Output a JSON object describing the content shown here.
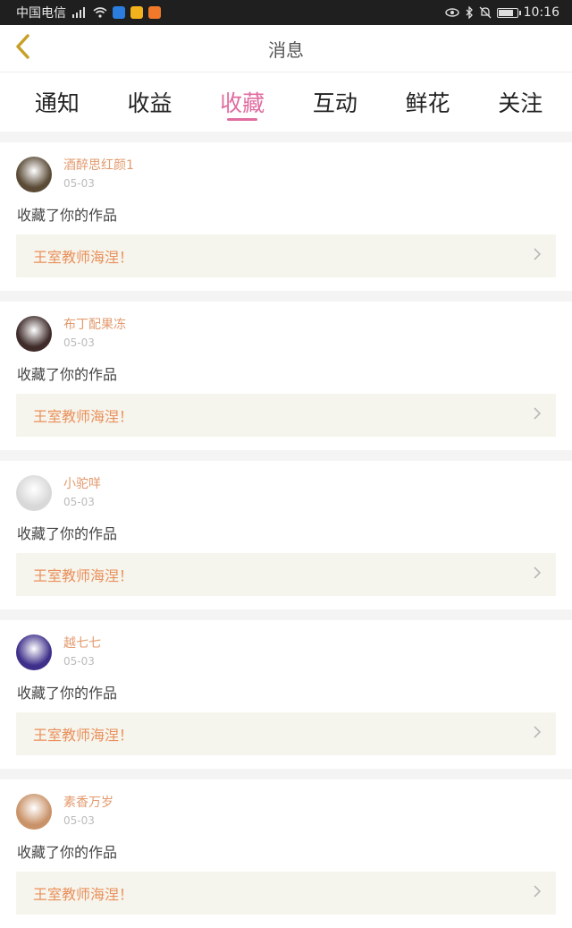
{
  "status_bar": {
    "carrier": "中国电信",
    "network": "3G",
    "time": "10:16",
    "battery_level": 0.85
  },
  "header": {
    "title": "消息",
    "back_icon": "chevron-left-icon",
    "back_icon_color": "#c8a028"
  },
  "tabs": [
    {
      "label": "通知",
      "active": false
    },
    {
      "label": "收益",
      "active": false
    },
    {
      "label": "收藏",
      "active": true
    },
    {
      "label": "互动",
      "active": false
    },
    {
      "label": "鲜花",
      "active": false
    },
    {
      "label": "关注",
      "active": false
    }
  ],
  "colors": {
    "accent": "#e06ca0",
    "username": "#e39a6e",
    "work_title": "#e9905b",
    "work_bg": "#f6f5ed"
  },
  "notifications": [
    {
      "user": "酒醉思红颜1",
      "date": "05-03",
      "action": "收藏了你的作品",
      "work": "王室教师海涅！",
      "avatar_color": "#5a4a36"
    },
    {
      "user": "布丁配果冻",
      "date": "05-03",
      "action": "收藏了你的作品",
      "work": "王室教师海涅！",
      "avatar_color": "#3e2b2a"
    },
    {
      "user": "小驼咩",
      "date": "05-03",
      "action": "收藏了你的作品",
      "work": "王室教师海涅！",
      "avatar_color": "#d8d8d8"
    },
    {
      "user": "越七七",
      "date": "05-03",
      "action": "收藏了你的作品",
      "work": "王室教师海涅！",
      "avatar_color": "#3d2f8a"
    },
    {
      "user": "素香万岁",
      "date": "05-03",
      "action": "收藏了你的作品",
      "work": "王室教师海涅！",
      "avatar_color": "#c99268"
    }
  ]
}
